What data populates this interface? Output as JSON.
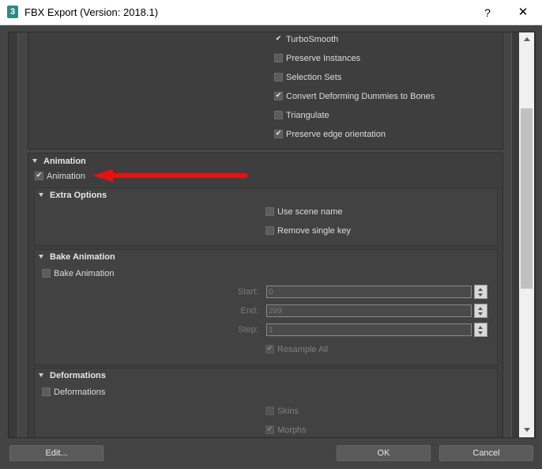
{
  "window": {
    "app_icon_text": "3",
    "title": "FBX Export (Version: 2018.1)",
    "help_label": "?",
    "close_label": "✕"
  },
  "geometry_panel": {
    "options": [
      {
        "label": "TurboSmooth",
        "checked": true
      },
      {
        "label": "Preserve Instances",
        "checked": false
      },
      {
        "label": "Selection Sets",
        "checked": false
      },
      {
        "label": "Convert Deforming Dummies to Bones",
        "checked": true
      },
      {
        "label": "Triangulate",
        "checked": false
      },
      {
        "label": "Preserve edge orientation",
        "checked": true
      }
    ]
  },
  "animation": {
    "title": "Animation",
    "checkbox_label": "Animation",
    "checked": true,
    "extra_options": {
      "title": "Extra Options",
      "use_scene_name": "Use scene name",
      "remove_single_key": "Remove single key"
    },
    "bake_animation": {
      "title": "Bake Animation",
      "checkbox_label": "Bake Animation",
      "start_label": "Start:",
      "start_value": "0",
      "end_label": "End:",
      "end_value": "299",
      "step_label": "Step:",
      "step_value": "1",
      "resample_all": "Resample All"
    },
    "deformations": {
      "title": "Deformations",
      "checkbox_label": "Deformations",
      "skins": "Skins",
      "morphs": "Morphs"
    }
  },
  "footer": {
    "edit_label": "Edit...",
    "ok_label": "OK",
    "cancel_label": "Cancel"
  },
  "colors": {
    "annotation_arrow": "#e81010"
  }
}
